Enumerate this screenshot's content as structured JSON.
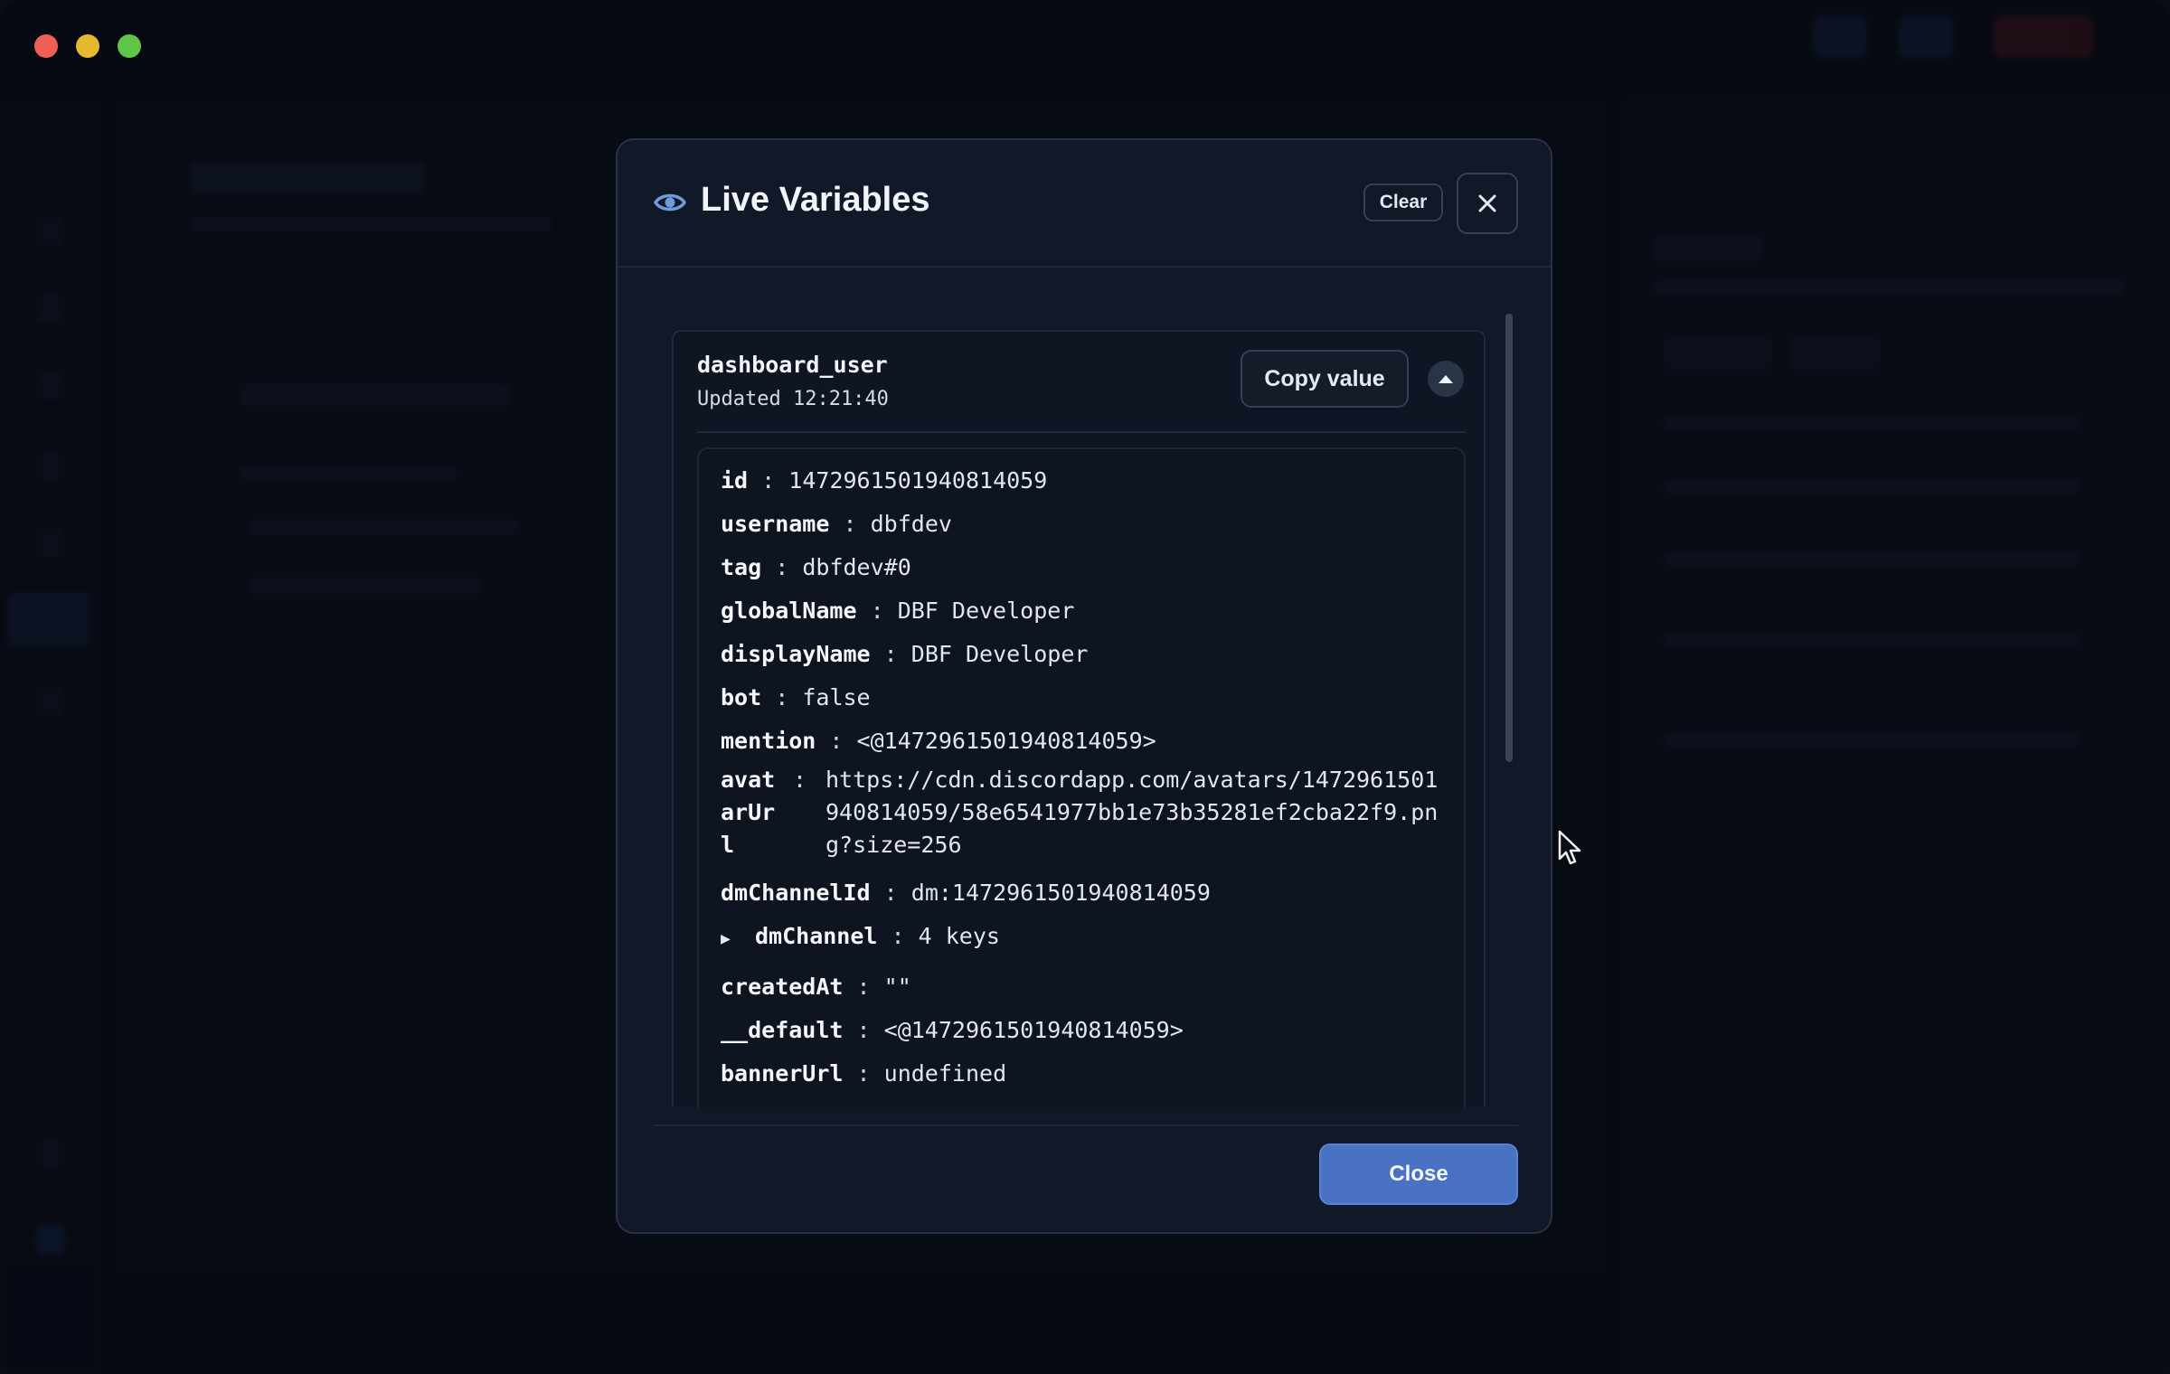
{
  "modal": {
    "title": "Live Variables",
    "clear_label": "Clear",
    "close_label": "Close"
  },
  "variable": {
    "name": "dashboard_user",
    "updated": "Updated 12:21:40",
    "copy_label": "Copy value",
    "fields": {
      "id": {
        "key": "id",
        "value": "1472961501940814059"
      },
      "username": {
        "key": "username",
        "value": "dbfdev"
      },
      "tag": {
        "key": "tag",
        "value": "dbfdev#0"
      },
      "globalName": {
        "key": "globalName",
        "value": "DBF Developer"
      },
      "displayName": {
        "key": "displayName",
        "value": "DBF Developer"
      },
      "bot": {
        "key": "bot",
        "value": "false"
      },
      "mention": {
        "key": "mention",
        "value": "<@1472961501940814059>"
      },
      "avatarUrl": {
        "key": "avatarUrl",
        "value": "https://cdn.discordapp.com/avatars/1472961501940814059/58e6541977bb1e73b35281ef2cba22f9.png?size=256"
      },
      "dmChannelId": {
        "key": "dmChannelId",
        "value": "dm:1472961501940814059"
      },
      "dmChannel": {
        "key": "dmChannel",
        "value": "4 keys"
      },
      "createdAt": {
        "key": "createdAt",
        "value": "\"\""
      },
      "default": {
        "key": "__default",
        "value": "<@1472961501940814059>"
      },
      "bannerUrl": {
        "key": "bannerUrl",
        "value": "undefined"
      }
    },
    "separator": ":"
  },
  "icons": {
    "modal_icon": "eye-icon",
    "close_icon": "close-icon",
    "collapse_icon": "chevron-up-icon",
    "expand_icon": "triangle-right-icon"
  },
  "colors": {
    "accent": "#4a72c4",
    "modal_bg": "#111827",
    "eye": "#6f9be0"
  }
}
